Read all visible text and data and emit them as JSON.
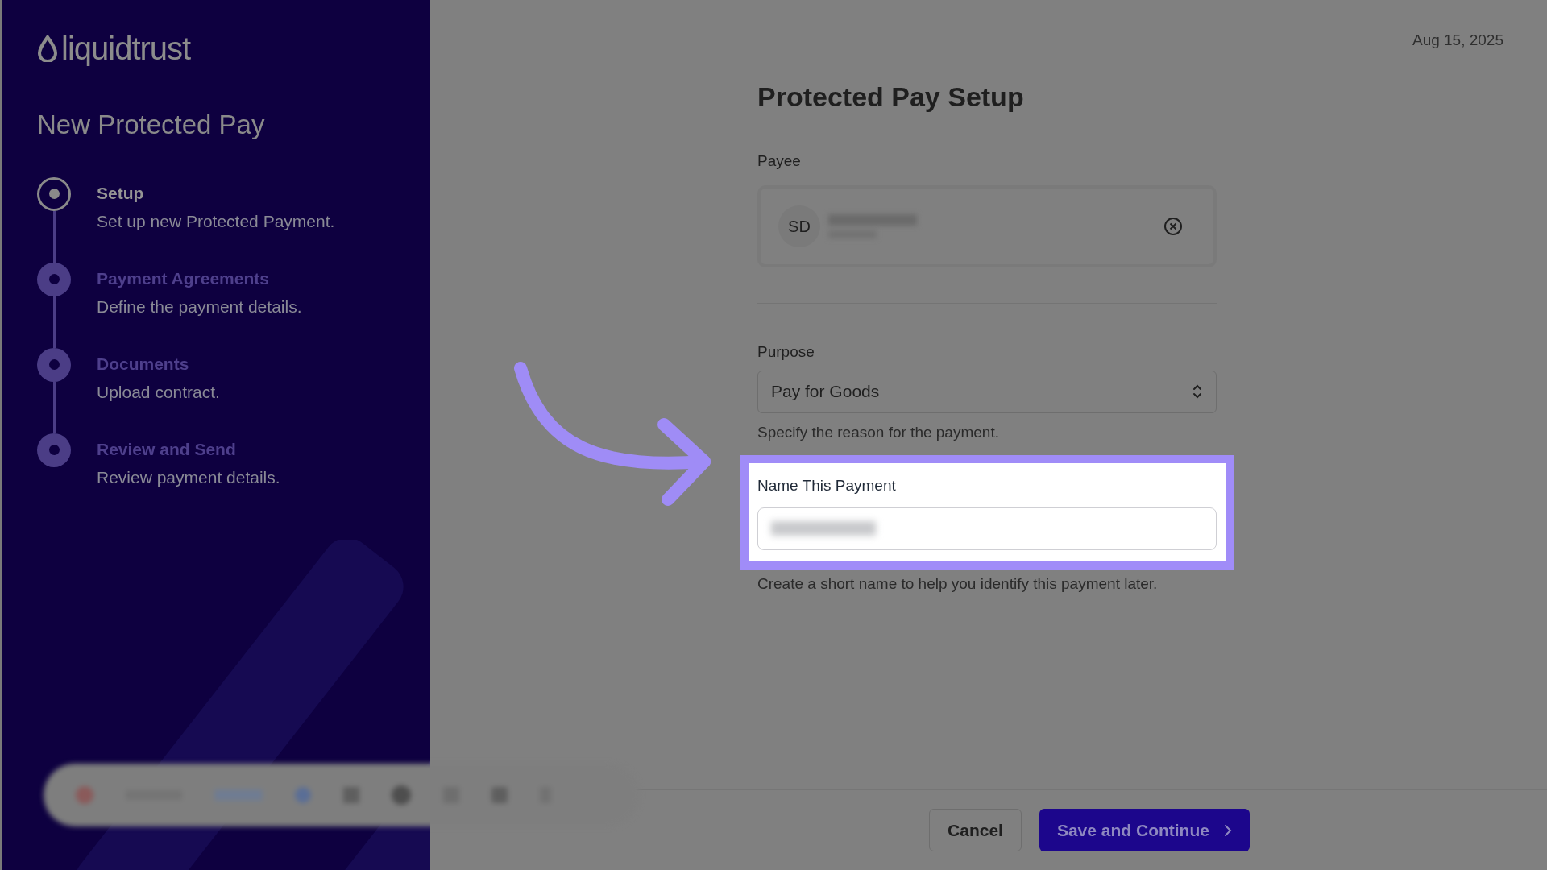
{
  "brand": {
    "name": "liquidtrust"
  },
  "sidebar": {
    "title": "New Protected Pay",
    "steps": [
      {
        "title": "Setup",
        "description": "Set up new Protected Payment.",
        "selected": true
      },
      {
        "title": "Payment Agreements",
        "description": "Define the payment details.",
        "selected": false
      },
      {
        "title": "Documents",
        "description": "Upload contract.",
        "selected": false
      },
      {
        "title": "Review and Send",
        "description": "Review payment details.",
        "selected": false
      }
    ]
  },
  "date": "Aug 15, 2025",
  "form": {
    "title": "Protected Pay Setup",
    "payee": {
      "label": "Payee",
      "initials": "SD"
    },
    "purpose": {
      "label": "Purpose",
      "value": "Pay for Goods",
      "hint": "Specify the reason for the payment."
    },
    "name": {
      "label": "Name This Payment",
      "hint": "Create a short name to help you identify this payment later.",
      "highlighted": true
    }
  },
  "buttons": [
    {
      "label": "Cancel",
      "kind": "secondary"
    },
    {
      "label": "Save and Continue",
      "kind": "primary"
    }
  ]
}
